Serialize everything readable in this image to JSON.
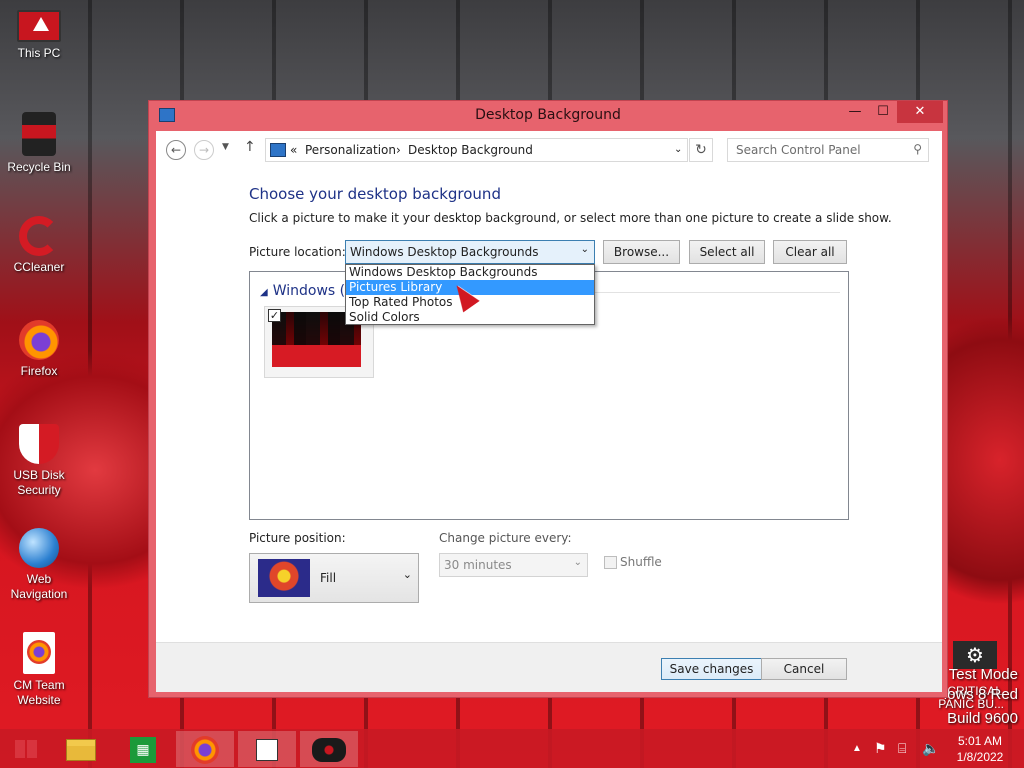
{
  "desktop": {
    "icons": [
      {
        "label": "This PC",
        "icon": "monitor-icon"
      },
      {
        "label": "Recycle Bin",
        "icon": "recycle-bin-icon"
      },
      {
        "label": "CCleaner",
        "icon": "ccleaner-icon"
      },
      {
        "label": "Firefox",
        "icon": "firefox-icon"
      },
      {
        "label": "USB Disk Security",
        "icon": "usb-shield-icon"
      },
      {
        "label": "Web Navigation",
        "icon": "globe-icon"
      },
      {
        "label": "CM Team Website",
        "icon": "firefox-document-icon"
      }
    ],
    "watermark": {
      "line1": "Test Mode",
      "line2": "CRITICAL",
      "line3": "PANIC BU...",
      "line4": "lows 8 Red",
      "line5": "Build 9600"
    }
  },
  "window": {
    "title": "Desktop Background",
    "controls": {
      "minimize": "—",
      "maximize": "☐",
      "close": "✕"
    },
    "address": {
      "prefix": "«",
      "crumbs": [
        "Personalization",
        "Desktop Background"
      ],
      "separator": "›"
    },
    "search_placeholder": "Search Control Panel",
    "heading": "Choose your desktop background",
    "description": "Click a picture to make it your desktop background, or select more than one picture to create a slide show.",
    "picture_location": {
      "label": "Picture location:",
      "value": "Windows Desktop Backgrounds",
      "options": [
        "Windows Desktop Backgrounds",
        "Pictures Library",
        "Top Rated Photos",
        "Solid Colors"
      ],
      "highlighted": "Pictures Library"
    },
    "buttons": {
      "browse": "Browse...",
      "select_all": "Select all",
      "clear_all": "Clear all"
    },
    "group_header": "Windows (1)",
    "thumbnail_checked": true,
    "picture_position": {
      "label": "Picture position:",
      "value": "Fill"
    },
    "change_every": {
      "label": "Change picture every:",
      "value": "30 minutes"
    },
    "shuffle_label": "Shuffle",
    "save_label": "Save changes",
    "cancel_label": "Cancel"
  },
  "taskbar": {
    "items": [
      "windows-start-icon",
      "file-explorer-icon",
      "store-icon",
      "firefox-icon",
      "control-panel-icon",
      "game-icon"
    ],
    "time": "5:01 AM",
    "date": "1/8/2022"
  },
  "colors": {
    "accent": "#e7636d",
    "highlight": "#3399ff",
    "heading": "#1e3287"
  }
}
